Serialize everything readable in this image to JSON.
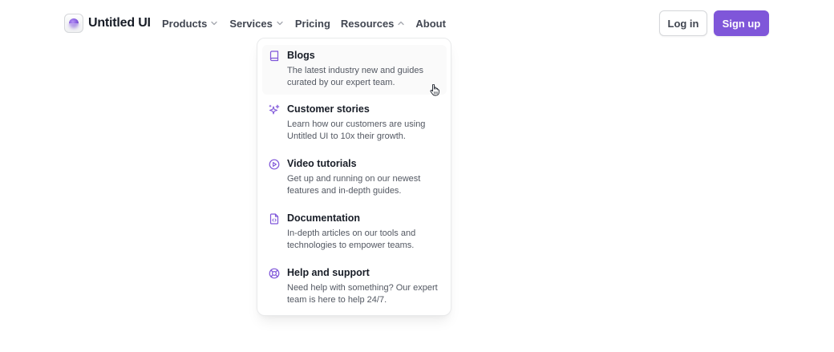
{
  "brand": {
    "name": "Untitled UI"
  },
  "nav": {
    "products": "Products",
    "services": "Services",
    "pricing": "Pricing",
    "resources": "Resources",
    "about": "About"
  },
  "auth": {
    "login": "Log in",
    "signup": "Sign up"
  },
  "resources_menu": {
    "items": [
      {
        "icon": "book-icon",
        "title": "Blogs",
        "description": "The latest industry new and guides curated by our expert team."
      },
      {
        "icon": "sparkle-icon",
        "title": "Customer stories",
        "description": "Learn how our customers are using Untitled UI to 10x their growth."
      },
      {
        "icon": "play-circle-icon",
        "title": "Video tutorials",
        "description": "Get up and running on our newest features and in-depth guides."
      },
      {
        "icon": "file-code-icon",
        "title": "Documentation",
        "description": "In-depth articles on our tools and technologies to empower teams."
      },
      {
        "icon": "life-buoy-icon",
        "title": "Help and support",
        "description": "Need help with something? Our expert team is here to help 24/7."
      }
    ]
  },
  "colors": {
    "brand": "#7f56d9",
    "text_primary": "#181d27",
    "text_secondary": "#535862",
    "border": "#d5d7da"
  }
}
